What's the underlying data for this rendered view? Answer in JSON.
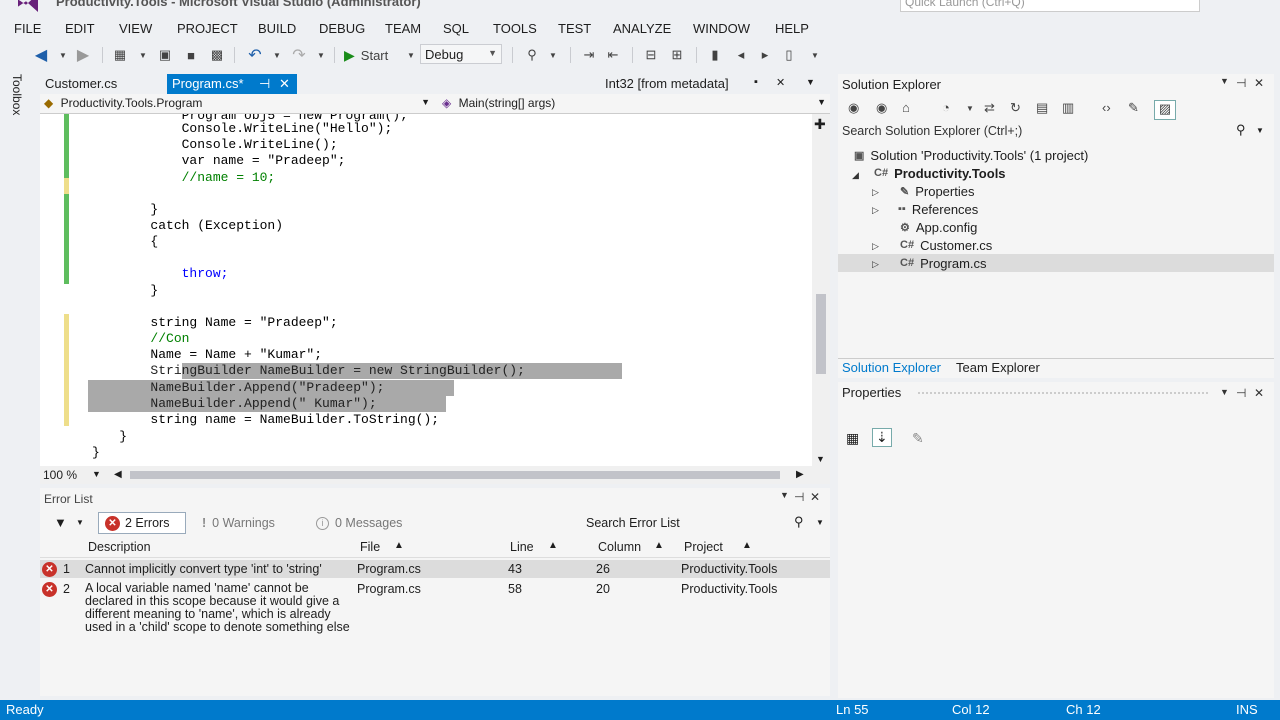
{
  "window": {
    "title": "Productivity.Tools - Microsoft Visual Studio (Administrator)",
    "quick_launch": "Quick Launch (Ctrl+Q)"
  },
  "menu": [
    "FILE",
    "EDIT",
    "VIEW",
    "PROJECT",
    "BUILD",
    "DEBUG",
    "TEAM",
    "SQL",
    "TOOLS",
    "TEST",
    "ANALYZE",
    "WINDOW",
    "HELP"
  ],
  "toolbar": {
    "start_label": "Start",
    "config": "Debug"
  },
  "toolbox_label": "Toolbox",
  "doc_tabs": {
    "tab1": "Customer.cs",
    "tab2": "Program.cs*",
    "preview": "Int32 [from metadata]"
  },
  "navbar": {
    "type": "Productivity.Tools.Program",
    "member": "Main(string[] args)"
  },
  "code": [
    "            Program obj5 = new Program();",
    "            Console.WriteLine(\"Hello\");",
    "            Console.WriteLine();",
    "            var name = \"Pradeep\";",
    "            //name = 10;",
    "",
    "",
    "        }",
    "        catch (Exception)",
    "        {",
    "",
    "            throw;",
    "        }",
    "",
    "        string Name = \"Pradeep\";",
    "        //Con",
    "        Name = Name + \"Kumar\";",
    "        StringBuilder NameBuilder = new StringBuilder();",
    "        NameBuilder.Append(\"Pradeep\");",
    "        NameBuilder.Append(\" Kumar\");",
    "        string name = NameBuilder.ToString();",
    "    }",
    "}"
  ],
  "editor": {
    "zoom": "100 %"
  },
  "error_list": {
    "title": "Error List",
    "errors_btn": "2 Errors",
    "warnings_btn": "0 Warnings",
    "messages_btn": "0 Messages",
    "search": "Search Error List",
    "columns": [
      "Description",
      "File",
      "Line",
      "Column",
      "Project"
    ],
    "rows": [
      {
        "num": "1",
        "description": "Cannot implicitly convert type 'int' to 'string'",
        "file": "Program.cs",
        "line": "43",
        "column": "26",
        "project": "Productivity.Tools"
      },
      {
        "num": "2",
        "description": "A local variable named 'name' cannot be declared in this scope because it would give a different meaning to 'name', which is already used in a 'child' scope to denote something else",
        "file": "Program.cs",
        "line": "58",
        "column": "20",
        "project": "Productivity.Tools"
      }
    ]
  },
  "solution_explorer": {
    "title": "Solution Explorer",
    "search": "Search Solution Explorer (Ctrl+;)",
    "solution": "Solution 'Productivity.Tools' (1 project)",
    "project": "Productivity.Tools",
    "items": [
      "Properties",
      "References",
      "App.config",
      "Customer.cs",
      "Program.cs"
    ],
    "tab_solution": "Solution Explorer",
    "tab_team": "Team Explorer"
  },
  "properties": {
    "title": "Properties"
  },
  "status": {
    "ready": "Ready",
    "ln": "Ln 55",
    "col": "Col 12",
    "ch": "Ch 12",
    "mode": "INS"
  },
  "colors": {
    "accent": "#007acc",
    "error": "#c8322a",
    "selection": "#a9a9a9"
  }
}
